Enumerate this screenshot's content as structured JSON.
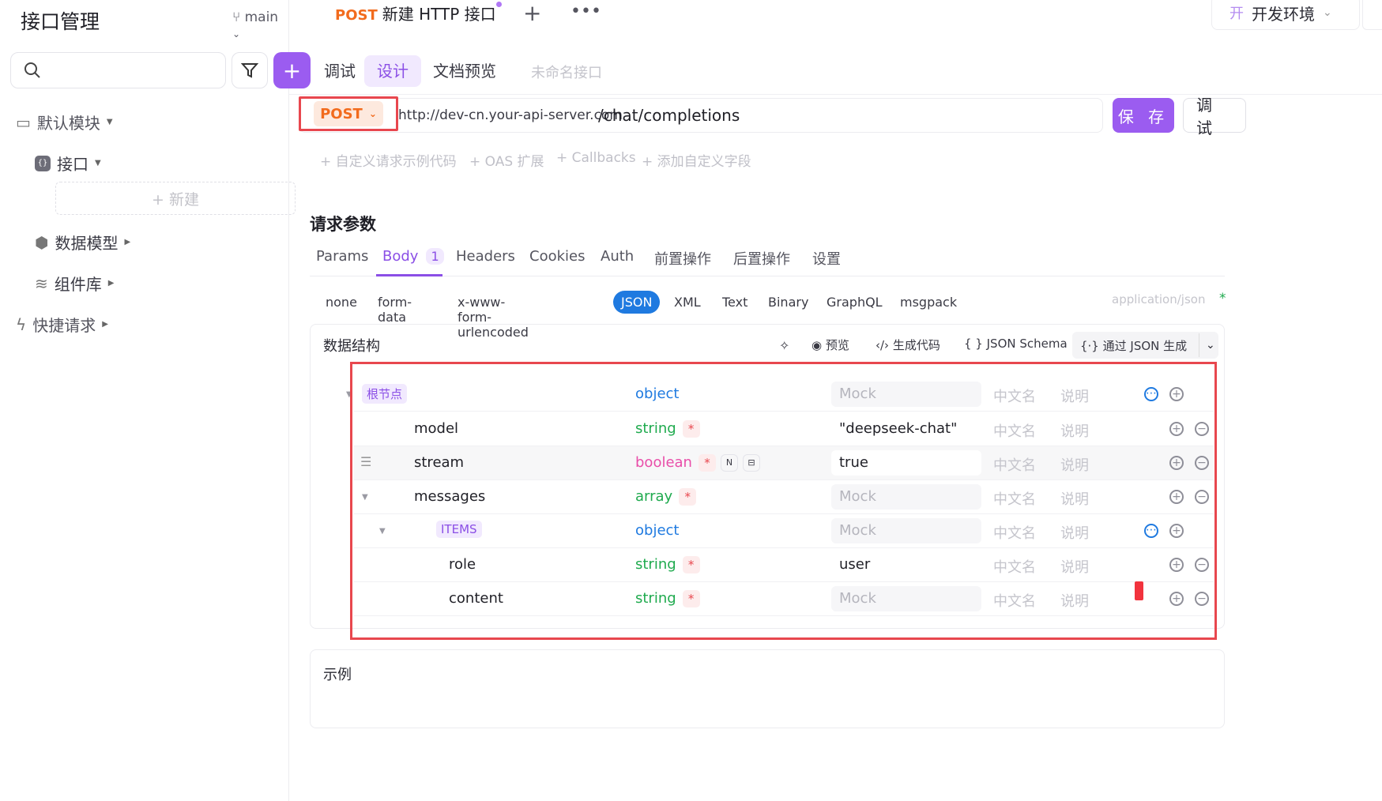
{
  "sidebar": {
    "title": "接口管理",
    "branch": "main",
    "search_placeholder": "",
    "items": [
      {
        "label": "默认模块"
      },
      {
        "label": "接口"
      },
      {
        "label": "+ 新建"
      },
      {
        "label": "数据模型"
      },
      {
        "label": "组件库"
      },
      {
        "label": "快捷请求"
      }
    ]
  },
  "tab": {
    "method": "POST",
    "title": "新建 HTTP 接口"
  },
  "env": {
    "badge": "开",
    "name": "开发环境"
  },
  "subtabs": [
    "调试",
    "设计",
    "文档预览"
  ],
  "unnamed": "未命名接口",
  "request": {
    "method": "POST",
    "host": "http://dev-cn.your-api-server.com",
    "path": "/chat/completions",
    "save": "保 存",
    "debug": "调 试"
  },
  "extensions": [
    "+ 自定义请求示例代码",
    "+ OAS 扩展",
    "+ Callbacks",
    "+ 添加自定义字段"
  ],
  "section_title": "请求参数",
  "param_tabs": [
    {
      "label": "Params"
    },
    {
      "label": "Body",
      "badge": "1"
    },
    {
      "label": "Headers"
    },
    {
      "label": "Cookies"
    },
    {
      "label": "Auth"
    },
    {
      "label": "前置操作"
    },
    {
      "label": "后置操作"
    },
    {
      "label": "设置"
    }
  ],
  "body_types": [
    "none",
    "form-data",
    "x-www-form-urlencoded",
    "JSON",
    "XML",
    "Text",
    "Binary",
    "GraphQL",
    "msgpack"
  ],
  "content_type": "application/json",
  "required_star": "*",
  "data_panel": {
    "title": "数据结构",
    "tools": [
      "预览",
      "生成代码",
      "JSON Schema",
      "通过 JSON 生成"
    ]
  },
  "fields": [
    {
      "name": "根节点",
      "type": "object",
      "mock": "Mock",
      "cn": "中文名",
      "desc": "说明"
    },
    {
      "name": "model",
      "type": "string",
      "mock": "\"deepseek-chat\"",
      "cn": "中文名",
      "desc": "说明"
    },
    {
      "name": "stream",
      "type": "boolean",
      "mock": "true",
      "cn": "中文名",
      "desc": "说明",
      "tag": "N"
    },
    {
      "name": "messages",
      "type": "array",
      "mock": "Mock",
      "cn": "中文名",
      "desc": "说明"
    },
    {
      "name": "ITEMS",
      "type": "object",
      "mock": "Mock",
      "cn": "中文名",
      "desc": "说明"
    },
    {
      "name": "role",
      "type": "string",
      "mock": "user",
      "cn": "中文名",
      "desc": "说明"
    },
    {
      "name": "content",
      "type": "string",
      "mock": "Mock",
      "cn": "中文名",
      "desc": "说明"
    }
  ],
  "example_title": "示例"
}
